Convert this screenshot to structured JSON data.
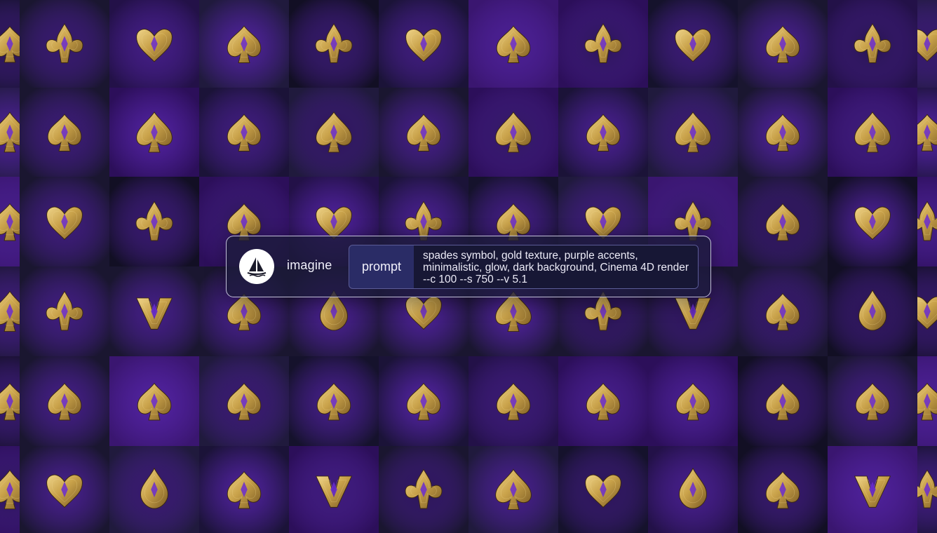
{
  "command_bar": {
    "logo_icon": "sailboat-logo-icon",
    "command": "imagine",
    "field_label": "prompt",
    "prompt_text": "spades symbol, gold texture, purple accents, minimalistic, glow, dark background, Cinema 4D render --c 100 --s 750 --v 5.1"
  },
  "gallery": {
    "rows": 6,
    "columns": 10,
    "subject": "gold spade-symbol variations",
    "colors": {
      "gold": "#c9a24a",
      "gold_light": "#f0d58a",
      "gold_dark": "#7a5a22",
      "purple": "#6a2bd0",
      "background": "#0d0b1c"
    }
  }
}
